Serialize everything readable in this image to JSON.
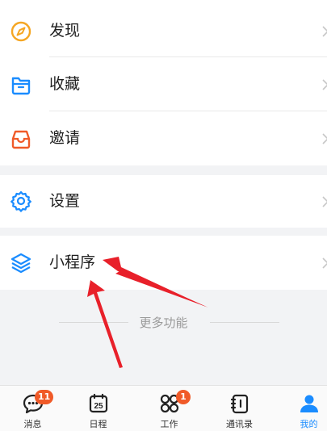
{
  "menu": {
    "discover_label": "发现",
    "favorites_label": "收藏",
    "invite_label": "邀请",
    "settings_label": "设置",
    "miniprogram_label": "小程序"
  },
  "more_functions_label": "更多功能",
  "tabbar": {
    "messages_label": "消息",
    "messages_badge": "11",
    "calendar_label": "日程",
    "calendar_day": "25",
    "work_label": "工作",
    "work_badge": "1",
    "contacts_label": "通讯录",
    "me_label": "我的"
  },
  "colors": {
    "discover_icon": "#f5a623",
    "favorites_icon": "#1a8cff",
    "invite_icon": "#f05a28",
    "settings_icon": "#1a8cff",
    "miniprogram_icon": "#1a8cff",
    "active_tab": "#1a8cff",
    "badge": "#f05a28",
    "annotation_arrow": "#e8202a"
  },
  "icons": {
    "discover": "compass-icon",
    "favorites": "folder-icon",
    "invite": "inbox-icon",
    "settings": "gear-icon",
    "miniprogram": "layers-icon",
    "chevron": "chevron-right-icon",
    "messages": "chat-bubble-icon",
    "calendar": "calendar-icon",
    "work": "grid-icon",
    "contacts": "contacts-book-icon",
    "me": "person-icon"
  }
}
